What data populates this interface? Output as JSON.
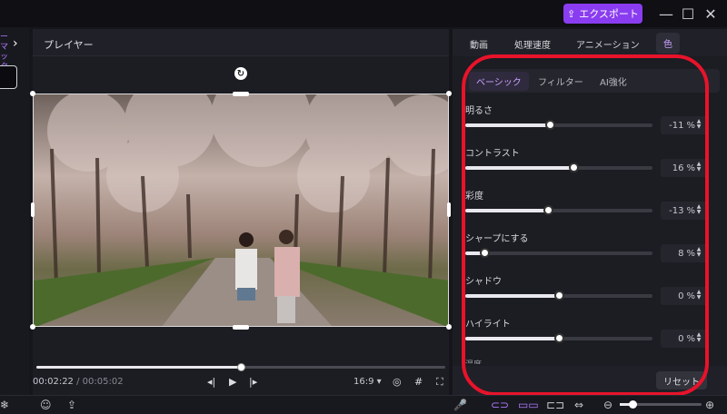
{
  "window": {
    "export_label": "エクスポート",
    "minimize": "—",
    "maximize": "☐",
    "close": "✕"
  },
  "left": {
    "label": "ーマッタ"
  },
  "player": {
    "title": "プレイヤー",
    "current_time": "00:02:22",
    "separator": "/",
    "total_time": "00:05:02",
    "progress": 0.5,
    "aspect_ratio": "16:9"
  },
  "tabs": [
    {
      "label": "動画"
    },
    {
      "label": "処理速度"
    },
    {
      "label": "アニメーション"
    },
    {
      "label": "色",
      "active": true
    }
  ],
  "subtabs": [
    {
      "label": "ベーシック",
      "active": true
    },
    {
      "label": "フィルター"
    },
    {
      "label": "AI強化"
    }
  ],
  "adjustments": [
    {
      "label": "明るさ",
      "value": "-11",
      "unit": "%",
      "fraction": 0.45
    },
    {
      "label": "コントラスト",
      "value": "16",
      "unit": "%",
      "fraction": 0.58
    },
    {
      "label": "彩度",
      "value": "-13",
      "unit": "%",
      "fraction": 0.44
    },
    {
      "label": "シャープにする",
      "value": "8",
      "unit": "%",
      "fraction": 0.1
    },
    {
      "label": "シャドウ",
      "value": "0",
      "unit": "%",
      "fraction": 0.5
    },
    {
      "label": "ハイライト",
      "value": "0",
      "unit": "%",
      "fraction": 0.5
    }
  ],
  "partial_label": "温度",
  "reset_label": "リセット",
  "zoom": {
    "level": 0.15
  },
  "colors": {
    "accent": "#8a3df0",
    "annotation": "#e8132a"
  }
}
